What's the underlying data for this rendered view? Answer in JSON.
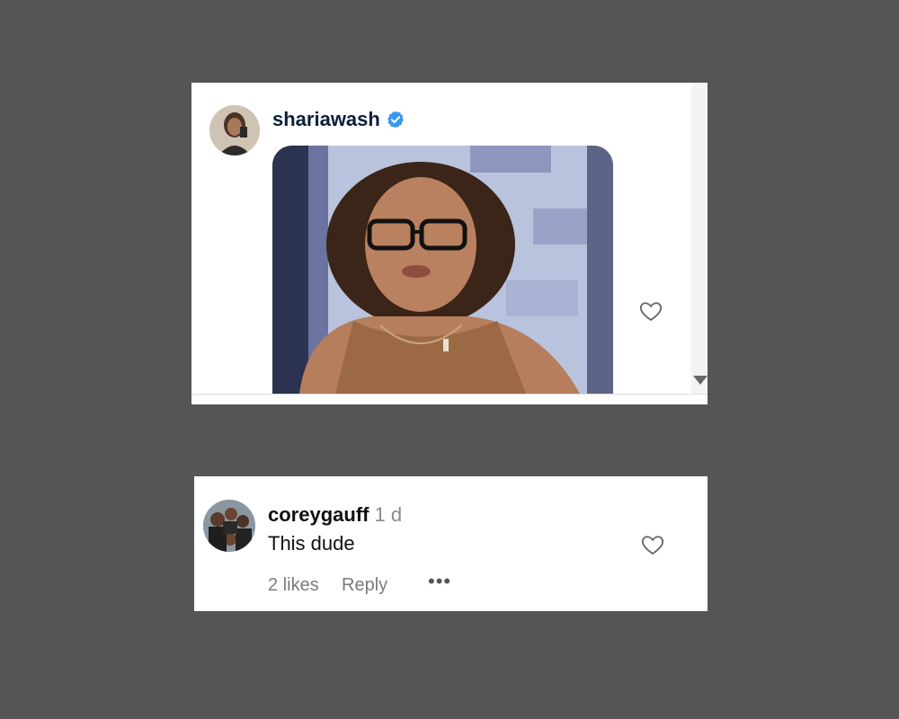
{
  "post": {
    "username": "shariawash",
    "verified": true,
    "media_alt": "animated gif of woman in glasses",
    "icons": {
      "like": "heart-outline-icon",
      "verified": "verified-badge-icon",
      "scroll": "scroll-down-arrow-icon"
    }
  },
  "comment": {
    "username": "coreygauff",
    "time": "1 d",
    "text": "This dude",
    "likes": "2 likes",
    "reply": "Reply",
    "more": "•••",
    "icons": {
      "like": "heart-outline-icon",
      "more": "more-options-icon"
    }
  },
  "colors": {
    "background": "#555555",
    "card": "#ffffff",
    "verified_blue": "#3897f0",
    "username_dark": "#0b1f3a"
  }
}
